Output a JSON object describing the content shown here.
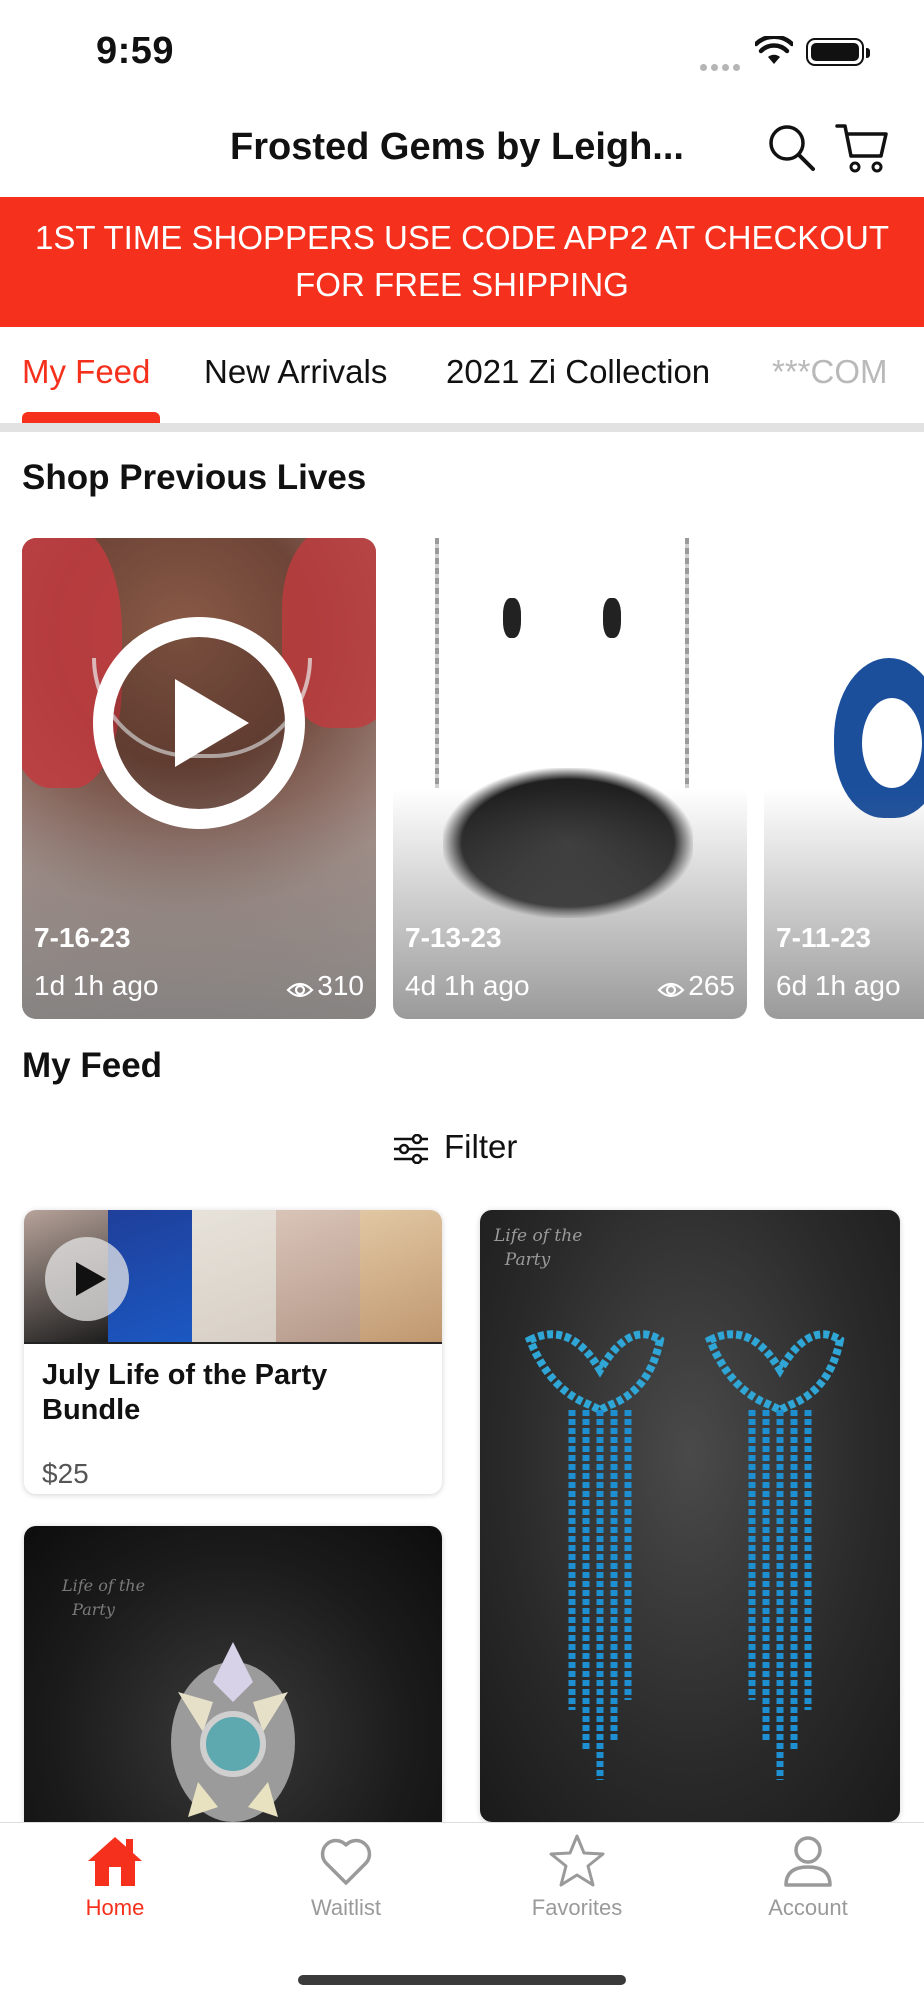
{
  "status_bar": {
    "time": "9:59"
  },
  "header": {
    "title": "Frosted Gems by Leigh..."
  },
  "promo": {
    "line1": "1ST TIME SHOPPERS USE CODE APP2 AT CHECKOUT",
    "line2": "FOR FREE SHIPPING"
  },
  "tabs": [
    {
      "label": "My Feed",
      "active": true
    },
    {
      "label": "New Arrivals"
    },
    {
      "label": "2021 Zi Collection"
    },
    {
      "label": "***COM"
    }
  ],
  "previous_lives": {
    "title": "Shop Previous Lives",
    "items": [
      {
        "date": "7-16-23",
        "ago": "1d 1h ago",
        "views": "310"
      },
      {
        "date": "7-13-23",
        "ago": "4d 1h ago",
        "views": "265"
      },
      {
        "date": "7-11-23",
        "ago": "6d 1h ago",
        "views": ""
      }
    ]
  },
  "feed": {
    "title": "My Feed",
    "filter_label": "Filter",
    "products": [
      {
        "name": "July Life of the Party Bundle",
        "price": "$25"
      },
      {
        "name": "",
        "price": ""
      },
      {
        "name": "",
        "price": ""
      }
    ]
  },
  "bottom_nav": [
    {
      "label": "Home",
      "icon": "home-icon",
      "active": true
    },
    {
      "label": "Waitlist",
      "icon": "heart-icon"
    },
    {
      "label": "Favorites",
      "icon": "star-icon"
    },
    {
      "label": "Account",
      "icon": "user-icon"
    }
  ],
  "colors": {
    "accent": "#f5301c",
    "muted": "#9a9a9a"
  }
}
